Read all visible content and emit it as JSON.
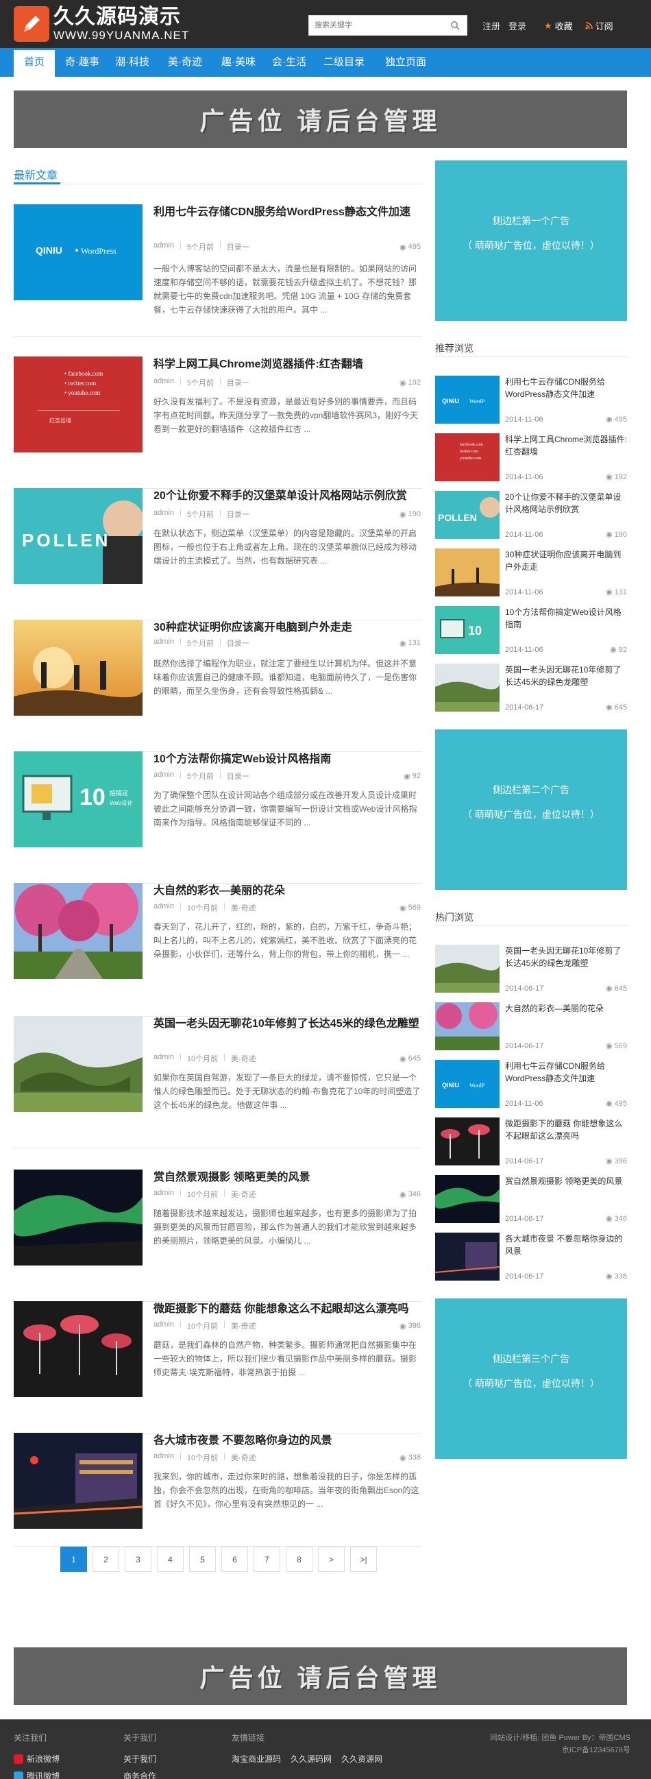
{
  "header": {
    "logo_title": "久久源码演示",
    "logo_sub": "WWW.99YUANMA.NET",
    "search_placeholder": "搜索关键字",
    "register": "注册",
    "login": "登录",
    "favorite": "收藏",
    "subscribe": "订阅"
  },
  "nav": [
    "首页",
    "奇·趣事",
    "潮·科技",
    "美·奇迹",
    "趣·美味",
    "会·生活",
    "二级目录",
    "独立页面"
  ],
  "ad_top": "广告位 请后台管理",
  "ad_bottom": "广告位 请后台管理",
  "section_title": "最新文章",
  "articles": [
    {
      "title": "利用七牛云存储CDN服务给WordPress静态文件加速",
      "author": "admin",
      "time": "5个月前",
      "cat": "目录一",
      "count": "495",
      "excerpt": "一般个人博客站的空间都不是太大，流量也是有限制的。如果网站的访问速度和存储空间不够的话，就需要花钱去升级虚拟主机了。不想花钱？那就需要七牛的免费cdn加速服务吧。凭借 10G 流量 + 10G 存储的免费套餐，七牛云存储快速获得了大批的用户。其中 ..."
    },
    {
      "title": "科学上网工具Chrome浏览器插件:红杏翻墙",
      "author": "admin",
      "time": "5个月前",
      "cat": "目录一",
      "count": "192",
      "excerpt": "好久没有发福利了。不是没有资源，是最近有好多别的事情要弄，而且码字有点花时间额。昨天刚分享了一款免费的vpn翻墙软件赛风3，刚好今天看到一款更好的翻墙插件（这款插件红杏 ..."
    },
    {
      "title": "20个让你爱不释手的汉堡菜单设计风格网站示例欣赏",
      "author": "admin",
      "time": "5个月前",
      "cat": "目录一",
      "count": "190",
      "excerpt": "在默认状态下，侧边菜单（汉堡菜单）的内容是隐藏的。汉堡菜单的开启图标，一般也位于右上角或者左上角。现在的汉堡菜单貌似已经成为移动端设计的主流模式了。当然，也有数据研究表 ..."
    },
    {
      "title": "30种症状证明你应该离开电脑到户外走走",
      "author": "admin",
      "time": "5个月前",
      "cat": "目录一",
      "count": "131",
      "excerpt": "既然你选择了编程作为职业，就注定了要经生以计算机为伴。但这并不意味着你应该置自己的健康不顾。谁都知道，电脑面前待久了，一是伤害你的眼睛，而至久坐伤身，还有会导致性格孤僻& ..."
    },
    {
      "title": "10个方法帮你搞定Web设计风格指南",
      "author": "admin",
      "time": "5个月前",
      "cat": "目录一",
      "count": "92",
      "excerpt": "为了确保整个团队在设计网站各个组成部分或在改善开发人员设计成果时彼此之间能够充分协调一致，你需要编写一份设计文档或Web设计风格指南来作为指导。风格指南能够保证不同的 ..."
    },
    {
      "title": "大自然的彩衣—美丽的花朵",
      "author": "admin",
      "time": "10个月前",
      "cat": "美·奇迹",
      "count": "569",
      "excerpt": "春天到了，花儿开了，红的，粉的，紫的，白的，万紫千红，争奇斗艳；叫上名儿的，叫不上名儿的，姹紫嫣红，美不胜收。欣赏了下面漂亮的花朵摄影，小伙伴们，还等什么，背上你的背包，带上你的相机，携一 ..."
    },
    {
      "title": "英国一老头因无聊花10年修剪了长达45米的绿色龙雕塑",
      "author": "admin",
      "time": "10个月前",
      "cat": "美·奇迹",
      "count": "645",
      "excerpt": "如果你在英国自驾游，发现了一条巨大的绿龙，请不要惊慌，它只是一个惟人的绿色雕塑而已。处于无聊状态的约翰·布鲁克花了10年的时间塑造了这个长45米的绿色龙。他做这件事 ..."
    },
    {
      "title": "赏自然景观摄影 领略更美的风景",
      "author": "admin",
      "time": "10个月前",
      "cat": "美·奇迹",
      "count": "346",
      "excerpt": "随着摄影技术越来越发达，摄影师也越来越多，也有更多的摄影师为了拍摄到更美的风景而甘愿冒险，那么作为普通人的我们才能欣赏到越来越多的美丽照片，领略更美的风景。小编倘儿 ..."
    },
    {
      "title": "微距摄影下的蘑菇 你能想象这么不起眼却这么漂亮吗",
      "author": "admin",
      "time": "10个月前",
      "cat": "美·奇迹",
      "count": "396",
      "excerpt": "蘑菇，是我们森林的自然产物，种类繁多。摄影师通常把自然摄影集中在一些较大的物体上，所以我们很少看见摄影作品中美丽多样的蘑菇。摄影师史蒂夫·埃克斯福特，非常热衷于拍摄 ..."
    },
    {
      "title": "各大城市夜景 不要忽略你身边的风景",
      "author": "admin",
      "time": "10个月前",
      "cat": "美·奇迹",
      "count": "338",
      "excerpt": "我来到，你的城市，走过你来时的路，想象着没我的日子，你是怎样的孤独，你会不会忽然的出现，在街角的咖啡店。当年夜的街角飘出Eson的这首《好久不见》，你心里有没有突然想见的一 ..."
    }
  ],
  "pager": [
    "1",
    "2",
    "3",
    "4",
    "5",
    "6",
    "7",
    "8",
    ">",
    ">|"
  ],
  "side_ads": [
    {
      "line1": "侧边栏第一个广告",
      "line2": "（ 萌萌哒广告位，虚位以待！）"
    },
    {
      "line1": "侧边栏第二个广告",
      "line2": "（ 萌萌哒广告位，虚位以待！）"
    },
    {
      "line1": "侧边栏第三个广告",
      "line2": "（ 萌萌哒广告位，虚位以待！）"
    }
  ],
  "recommend_title": "推荐浏览",
  "recommend": [
    {
      "title": "利用七牛云存储CDN服务给WordPress静态文件加速",
      "date": "2014-11-06",
      "count": "495"
    },
    {
      "title": "科学上网工具Chrome浏览器插件:红杏翻墙",
      "date": "2014-11-06",
      "count": "192"
    },
    {
      "title": "20个让你爱不释手的汉堡菜单设计风格网站示例欣赏",
      "date": "2014-11-06",
      "count": "190"
    },
    {
      "title": "30种症状证明你应该离开电脑到户外走走",
      "date": "2014-11-06",
      "count": "131"
    },
    {
      "title": "10个方法帮你搞定Web设计风格指南",
      "date": "2014-11-06",
      "count": "92"
    },
    {
      "title": "英国一老头因无聊花10年修剪了长达45米的绿色龙雕塑",
      "date": "2014-06-17",
      "count": "645"
    }
  ],
  "hot_title": "热门浏览",
  "hot": [
    {
      "title": "英国一老头因无聊花10年修剪了长达45米的绿色龙雕塑",
      "date": "2014-06-17",
      "count": "645"
    },
    {
      "title": "大自然的彩衣—美丽的花朵",
      "date": "2014-06-17",
      "count": "569"
    },
    {
      "title": "利用七牛云存储CDN服务给WordPress静态文件加速",
      "date": "2014-11-06",
      "count": "495"
    },
    {
      "title": "微距摄影下的蘑菇 你能想象这么不起眼却这么漂亮吗",
      "date": "2014-06-17",
      "count": "396"
    },
    {
      "title": "赏自然景观摄影 领略更美的风景",
      "date": "2014-06-17",
      "count": "346"
    },
    {
      "title": "各大城市夜景 不要忽略你身边的风景",
      "date": "2014-06-17",
      "count": "338"
    }
  ],
  "footer": {
    "follow_title": "关注我们",
    "follow_1": "新浪微博",
    "follow_2": "腾讯微博",
    "about_title": "关于我们",
    "about_1": "关于我们",
    "about_2": "商务合作",
    "links_title": "友情链接",
    "link_1": "淘宝商业源码",
    "link_2": "久久源码网",
    "link_3": "久久资源网",
    "copy_1": "网站设计/移植: 团鱼 Power By：帝国CMS",
    "copy_2": "京ICP备12345678号"
  }
}
